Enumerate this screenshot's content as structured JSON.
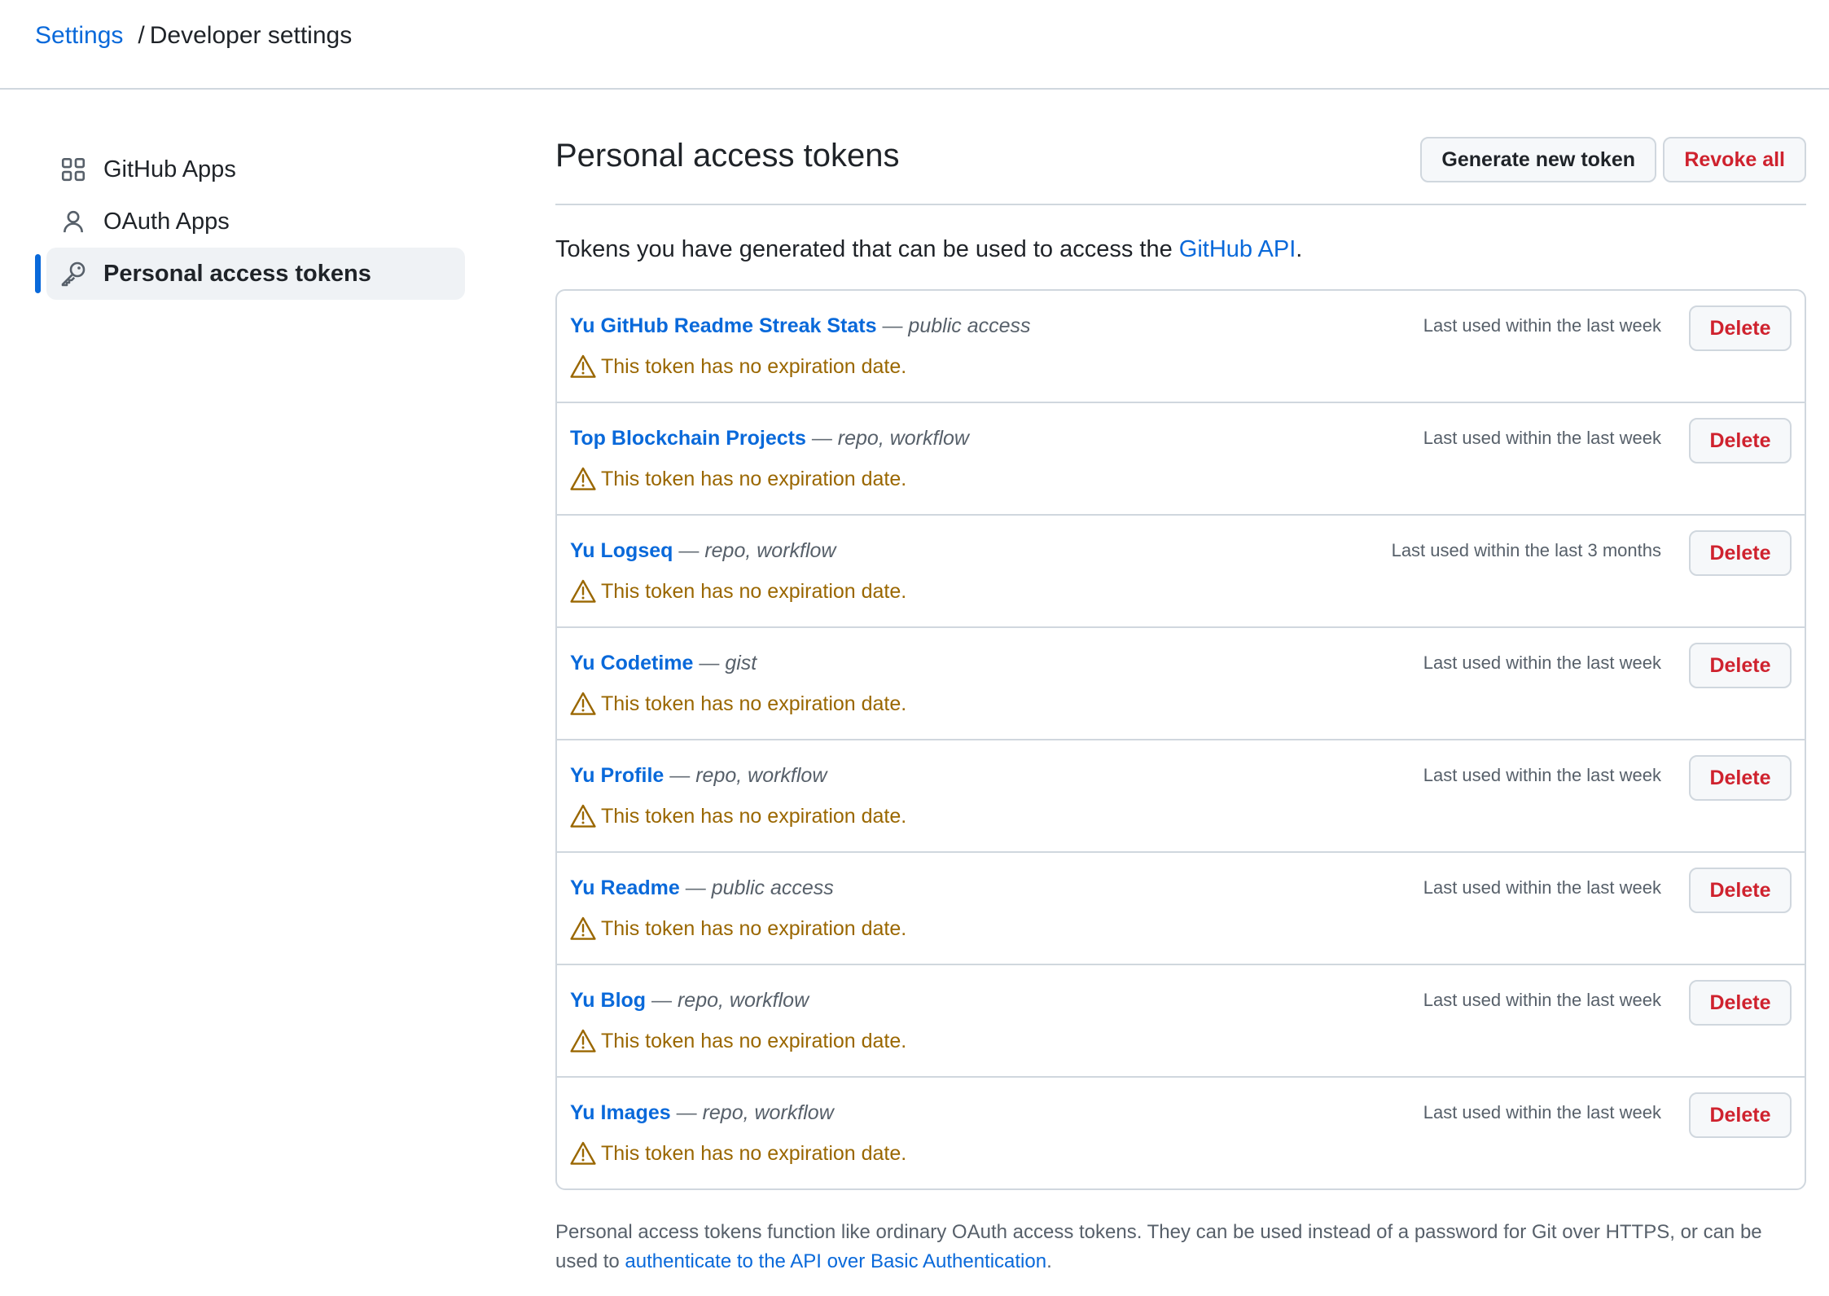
{
  "breadcrumb": {
    "root": "Settings",
    "separator": "/",
    "current": "Developer settings"
  },
  "sidebar": {
    "items": [
      {
        "label": "GitHub Apps",
        "icon": "apps-grid-icon",
        "active": false
      },
      {
        "label": "OAuth Apps",
        "icon": "person-icon",
        "active": false
      },
      {
        "label": "Personal access tokens",
        "icon": "key-icon",
        "active": true
      }
    ]
  },
  "main": {
    "title": "Personal access tokens",
    "generate_label": "Generate new token",
    "revoke_label": "Revoke all",
    "intro_prefix": "Tokens you have generated that can be used to access the ",
    "intro_link": "GitHub API",
    "intro_suffix": ".",
    "footnote_prefix": "Personal access tokens function like ordinary OAuth access tokens. They can be used instead of a password for Git over HTTPS, or can be used to ",
    "footnote_link": "authenticate to the API over Basic Authentication",
    "footnote_suffix": "."
  },
  "tokens": [
    {
      "name": "Yu GitHub Readme Streak Stats",
      "dash": "—",
      "scopes": "public access",
      "warning": "This token has no expiration date.",
      "last_used": "Last used within the last week",
      "delete_label": "Delete"
    },
    {
      "name": "Top Blockchain Projects",
      "dash": "—",
      "scopes": "repo, workflow",
      "warning": "This token has no expiration date.",
      "last_used": "Last used within the last week",
      "delete_label": "Delete"
    },
    {
      "name": "Yu Logseq",
      "dash": "—",
      "scopes": "repo, workflow",
      "warning": "This token has no expiration date.",
      "last_used": "Last used within the last 3 months",
      "delete_label": "Delete"
    },
    {
      "name": "Yu Codetime",
      "dash": "—",
      "scopes": "gist",
      "warning": "This token has no expiration date.",
      "last_used": "Last used within the last week",
      "delete_label": "Delete"
    },
    {
      "name": "Yu Profile",
      "dash": "—",
      "scopes": "repo, workflow",
      "warning": "This token has no expiration date.",
      "last_used": "Last used within the last week",
      "delete_label": "Delete"
    },
    {
      "name": "Yu Readme",
      "dash": "—",
      "scopes": "public access",
      "warning": "This token has no expiration date.",
      "last_used": "Last used within the last week",
      "delete_label": "Delete"
    },
    {
      "name": "Yu Blog",
      "dash": "—",
      "scopes": "repo, workflow",
      "warning": "This token has no expiration date.",
      "last_used": "Last used within the last week",
      "delete_label": "Delete"
    },
    {
      "name": "Yu Images",
      "dash": "—",
      "scopes": "repo, workflow",
      "warning": "This token has no expiration date.",
      "last_used": "Last used within the last week",
      "delete_label": "Delete"
    }
  ],
  "colors": {
    "link": "#0969da",
    "danger": "#cf222e",
    "warning": "#9a6700",
    "border": "#d0d7de",
    "active_bar": "#0969da"
  }
}
